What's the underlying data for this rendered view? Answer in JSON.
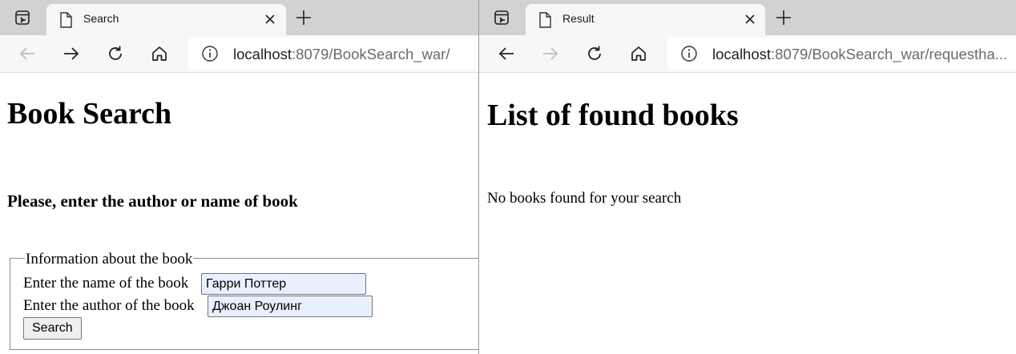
{
  "left_window": {
    "tab": {
      "title": "Search",
      "icon": "document-icon"
    },
    "address": {
      "host": "localhost",
      "path": ":8079/BookSearch_war/"
    },
    "page": {
      "heading": "Book Search",
      "subheading": "Please, enter the author or name of book",
      "fieldset": {
        "legend": "Information about the book",
        "name_label": "Enter the name of the book",
        "name_value": "Гарри Поттер",
        "author_label": "Enter the author of the book",
        "author_value": "Джоан Роулинг",
        "submit_label": "Search"
      }
    }
  },
  "right_window": {
    "tab": {
      "title": "Result",
      "icon": "document-icon"
    },
    "address": {
      "host": "localhost",
      "path": ":8079/BookSearch_war/requestha..."
    },
    "page": {
      "heading": "List of found books",
      "message": "No books found for your search"
    }
  },
  "colors": {
    "tabstrip_bg": "#d2d2d2",
    "toolbar_bg": "#f7f7f7",
    "autofill_bg": "#e8f0fe"
  }
}
